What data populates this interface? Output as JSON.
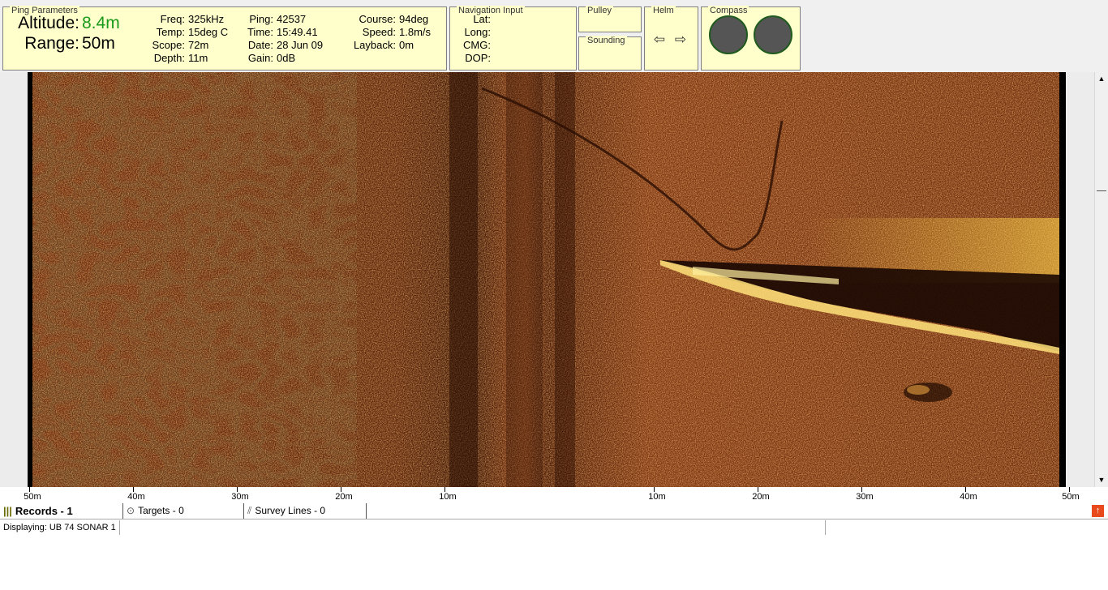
{
  "ping_parameters": {
    "title": "Ping Parameters",
    "altitude_label": "Altitude:",
    "altitude_value": "8.4m",
    "range_label": "Range:",
    "range_value": "50m",
    "rows": [
      {
        "freq_label": "Freq:",
        "freq": "325kHz",
        "ping_label": "Ping:",
        "ping": "42537",
        "course_label": "Course:",
        "course": "94deg"
      },
      {
        "temp_label": "Temp:",
        "temp": "15deg C",
        "time_label": "Time:",
        "time": "15:49.41",
        "speed_label": "Speed:",
        "speed": "1.8m/s"
      },
      {
        "scope_label": "Scope:",
        "scope": "72m",
        "date_label": "Date:",
        "date": "28 Jun 09",
        "layback_label": "Layback:",
        "layback": "0m"
      },
      {
        "depth_label": "Depth:",
        "depth": "11m",
        "gain_label": "Gain:",
        "gain": "0dB"
      }
    ]
  },
  "navigation_input": {
    "title": "Navigation Input",
    "lat_label": "Lat:",
    "long_label": "Long:",
    "cmg_label": "CMG:",
    "dop_label": "DOP:"
  },
  "pulley": {
    "title": "Pulley"
  },
  "sounding": {
    "title": "Sounding"
  },
  "helm": {
    "title": "Helm",
    "left_icon": "arrow-left-icon",
    "right_icon": "arrow-right-icon"
  },
  "compass": {
    "title": "Compass"
  },
  "axis": {
    "ticks": [
      "50m",
      "40m",
      "30m",
      "20m",
      "10m",
      "10m",
      "20m",
      "30m",
      "40m",
      "50m"
    ]
  },
  "tabs": {
    "records": "Records - 1",
    "targets": "Targets - 0",
    "survey_lines": "Survey Lines - 0"
  },
  "status": {
    "displaying": "Displaying: UB 74 SONAR 1"
  },
  "colors": {
    "panel_bg": "#ffffcc",
    "altitude_green": "#1a9a1a",
    "sonar_base": "#6b2e0f",
    "sonar_highlight": "#ffd24a"
  }
}
